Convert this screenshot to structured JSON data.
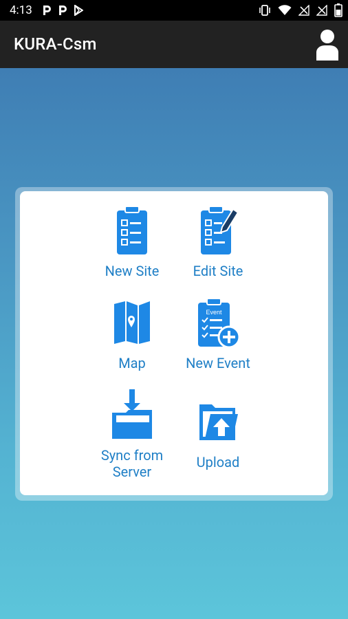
{
  "status_bar": {
    "time": "4:13"
  },
  "app_bar": {
    "title": "KURA-Csm"
  },
  "menu": {
    "new_site": "New Site",
    "edit_site": "Edit Site",
    "map": "Map",
    "new_event": "New Event",
    "new_event_icon_text": "Event",
    "sync_line1": "Sync from",
    "sync_line2": "Server",
    "upload": "Upload"
  },
  "colors": {
    "accent": "#1f7fc6",
    "icon_blue": "#1e88e5",
    "app_bar": "#222222"
  }
}
